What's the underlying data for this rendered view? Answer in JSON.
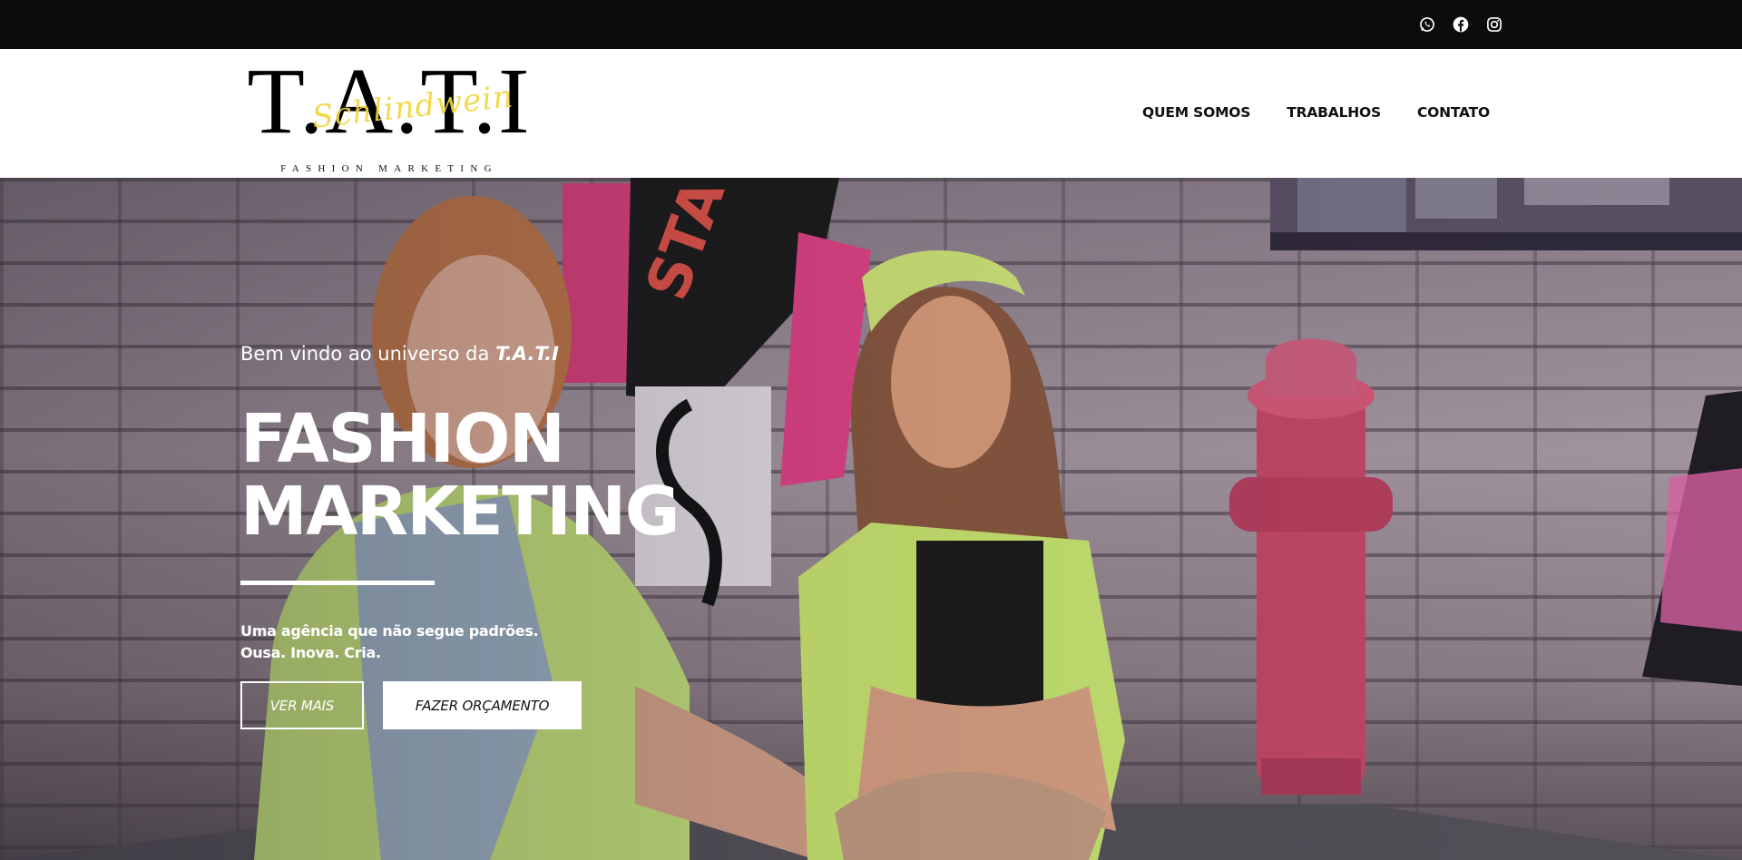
{
  "topbar": {
    "socials": [
      {
        "icon": "whatsapp-icon"
      },
      {
        "icon": "facebook-icon"
      },
      {
        "icon": "instagram-icon"
      }
    ]
  },
  "header": {
    "logo": {
      "main": "T.A.T.I",
      "script": "Schlindwein",
      "sub": "FASHION MARKETING"
    },
    "nav": [
      {
        "label": "QUEM SOMOS"
      },
      {
        "label": "TRABALHOS"
      },
      {
        "label": "CONTATO"
      }
    ]
  },
  "hero": {
    "welcome_prefix": "Bem vindo ao universo da ",
    "welcome_brand": "T.A.T.I",
    "title_line1": "FASHION",
    "title_line2": "MARKETING",
    "tagline_line1": "Uma agência que não segue padrões.",
    "tagline_line2": "Ousa. Inova. Cria.",
    "button_more": "VER MAIS",
    "button_quote": "FAZER ORÇAMENTO"
  },
  "colors": {
    "topbar": "#0c0c0c",
    "accent_logo": "#f2d53a",
    "text_light": "#ffffff",
    "text_dark": "#111111"
  }
}
